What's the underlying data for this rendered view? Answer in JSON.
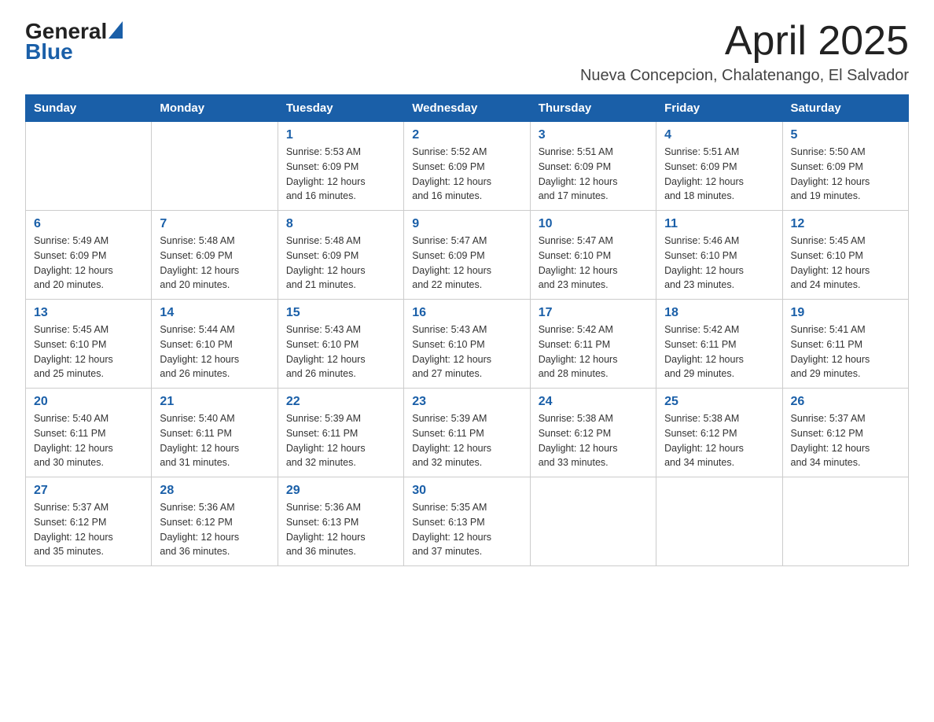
{
  "logo": {
    "general": "General",
    "blue": "Blue"
  },
  "title": "April 2025",
  "subtitle": "Nueva Concepcion, Chalatenango, El Salvador",
  "weekdays": [
    "Sunday",
    "Monday",
    "Tuesday",
    "Wednesday",
    "Thursday",
    "Friday",
    "Saturday"
  ],
  "weeks": [
    [
      {
        "day": "",
        "info": ""
      },
      {
        "day": "",
        "info": ""
      },
      {
        "day": "1",
        "info": "Sunrise: 5:53 AM\nSunset: 6:09 PM\nDaylight: 12 hours\nand 16 minutes."
      },
      {
        "day": "2",
        "info": "Sunrise: 5:52 AM\nSunset: 6:09 PM\nDaylight: 12 hours\nand 16 minutes."
      },
      {
        "day": "3",
        "info": "Sunrise: 5:51 AM\nSunset: 6:09 PM\nDaylight: 12 hours\nand 17 minutes."
      },
      {
        "day": "4",
        "info": "Sunrise: 5:51 AM\nSunset: 6:09 PM\nDaylight: 12 hours\nand 18 minutes."
      },
      {
        "day": "5",
        "info": "Sunrise: 5:50 AM\nSunset: 6:09 PM\nDaylight: 12 hours\nand 19 minutes."
      }
    ],
    [
      {
        "day": "6",
        "info": "Sunrise: 5:49 AM\nSunset: 6:09 PM\nDaylight: 12 hours\nand 20 minutes."
      },
      {
        "day": "7",
        "info": "Sunrise: 5:48 AM\nSunset: 6:09 PM\nDaylight: 12 hours\nand 20 minutes."
      },
      {
        "day": "8",
        "info": "Sunrise: 5:48 AM\nSunset: 6:09 PM\nDaylight: 12 hours\nand 21 minutes."
      },
      {
        "day": "9",
        "info": "Sunrise: 5:47 AM\nSunset: 6:09 PM\nDaylight: 12 hours\nand 22 minutes."
      },
      {
        "day": "10",
        "info": "Sunrise: 5:47 AM\nSunset: 6:10 PM\nDaylight: 12 hours\nand 23 minutes."
      },
      {
        "day": "11",
        "info": "Sunrise: 5:46 AM\nSunset: 6:10 PM\nDaylight: 12 hours\nand 23 minutes."
      },
      {
        "day": "12",
        "info": "Sunrise: 5:45 AM\nSunset: 6:10 PM\nDaylight: 12 hours\nand 24 minutes."
      }
    ],
    [
      {
        "day": "13",
        "info": "Sunrise: 5:45 AM\nSunset: 6:10 PM\nDaylight: 12 hours\nand 25 minutes."
      },
      {
        "day": "14",
        "info": "Sunrise: 5:44 AM\nSunset: 6:10 PM\nDaylight: 12 hours\nand 26 minutes."
      },
      {
        "day": "15",
        "info": "Sunrise: 5:43 AM\nSunset: 6:10 PM\nDaylight: 12 hours\nand 26 minutes."
      },
      {
        "day": "16",
        "info": "Sunrise: 5:43 AM\nSunset: 6:10 PM\nDaylight: 12 hours\nand 27 minutes."
      },
      {
        "day": "17",
        "info": "Sunrise: 5:42 AM\nSunset: 6:11 PM\nDaylight: 12 hours\nand 28 minutes."
      },
      {
        "day": "18",
        "info": "Sunrise: 5:42 AM\nSunset: 6:11 PM\nDaylight: 12 hours\nand 29 minutes."
      },
      {
        "day": "19",
        "info": "Sunrise: 5:41 AM\nSunset: 6:11 PM\nDaylight: 12 hours\nand 29 minutes."
      }
    ],
    [
      {
        "day": "20",
        "info": "Sunrise: 5:40 AM\nSunset: 6:11 PM\nDaylight: 12 hours\nand 30 minutes."
      },
      {
        "day": "21",
        "info": "Sunrise: 5:40 AM\nSunset: 6:11 PM\nDaylight: 12 hours\nand 31 minutes."
      },
      {
        "day": "22",
        "info": "Sunrise: 5:39 AM\nSunset: 6:11 PM\nDaylight: 12 hours\nand 32 minutes."
      },
      {
        "day": "23",
        "info": "Sunrise: 5:39 AM\nSunset: 6:11 PM\nDaylight: 12 hours\nand 32 minutes."
      },
      {
        "day": "24",
        "info": "Sunrise: 5:38 AM\nSunset: 6:12 PM\nDaylight: 12 hours\nand 33 minutes."
      },
      {
        "day": "25",
        "info": "Sunrise: 5:38 AM\nSunset: 6:12 PM\nDaylight: 12 hours\nand 34 minutes."
      },
      {
        "day": "26",
        "info": "Sunrise: 5:37 AM\nSunset: 6:12 PM\nDaylight: 12 hours\nand 34 minutes."
      }
    ],
    [
      {
        "day": "27",
        "info": "Sunrise: 5:37 AM\nSunset: 6:12 PM\nDaylight: 12 hours\nand 35 minutes."
      },
      {
        "day": "28",
        "info": "Sunrise: 5:36 AM\nSunset: 6:12 PM\nDaylight: 12 hours\nand 36 minutes."
      },
      {
        "day": "29",
        "info": "Sunrise: 5:36 AM\nSunset: 6:13 PM\nDaylight: 12 hours\nand 36 minutes."
      },
      {
        "day": "30",
        "info": "Sunrise: 5:35 AM\nSunset: 6:13 PM\nDaylight: 12 hours\nand 37 minutes."
      },
      {
        "day": "",
        "info": ""
      },
      {
        "day": "",
        "info": ""
      },
      {
        "day": "",
        "info": ""
      }
    ]
  ]
}
